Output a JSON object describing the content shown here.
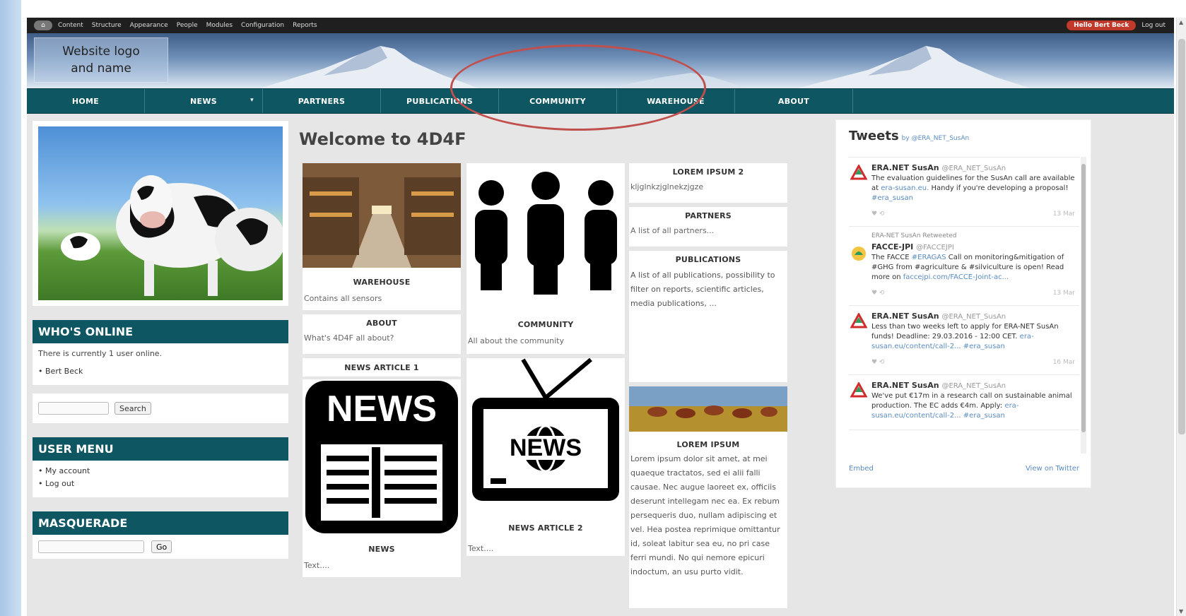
{
  "admin_toolbar": {
    "home_label": "⌂",
    "items": [
      "Content",
      "Structure",
      "Appearance",
      "People",
      "Modules",
      "Configuration",
      "Reports"
    ],
    "hello": "Hello Bert Beck",
    "logout": "Log out"
  },
  "header": {
    "logo_text_line1": "Website logo",
    "logo_text_line2": "and name"
  },
  "nav": {
    "items": [
      "HOME",
      "NEWS",
      "PARTNERS",
      "PUBLICATIONS",
      "COMMUNITY",
      "WAREHOUSE",
      "ABOUT"
    ],
    "news_caret": "▾"
  },
  "left": {
    "whos_online_title": "WHO'S ONLINE",
    "whos_online_text": "There is currently 1 user online.",
    "online_user": "Bert Beck",
    "search_button": "Search",
    "user_menu_title": "USER MENU",
    "user_menu_items": [
      "My account",
      "Log out"
    ],
    "masquerade_title": "MASQUERADE",
    "masquerade_button": "Go"
  },
  "main": {
    "welcome_title": "Welcome to 4D4F",
    "cards": {
      "warehouse_title": "WAREHOUSE",
      "warehouse_text": "Contains all sensors",
      "community_title": "COMMUNITY",
      "community_text": "All about the community",
      "about_title": "ABOUT",
      "about_text": "What's 4D4F all about?",
      "lorem2_title": "LOREM IPSUM 2",
      "lorem2_text": "kljglnkzjglnekzjgze",
      "partners_title": "PARTNERS",
      "partners_text": "A list of all partners...",
      "publications_title": "PUBLICATIONS",
      "publications_text": "A list of all publications, possibility to filter on reports, scientific articles, media publications, ...",
      "news_article1_title": "NEWS ARTICLE 1",
      "news_icon_text": "NEWS",
      "news_title": "NEWS",
      "news_text": "Text....",
      "news_article2_title": "NEWS ARTICLE 2",
      "tv_news_text": "NEWS",
      "news_article2_text": "Text....",
      "lorem_title": "LOREM IPSUM",
      "lorem_text": "Lorem ipsum dolor sit amet, at mei quaeque tractatos, sed ei alii falli causae. Nec augue laoreet ex, officiis deserunt intellegam nec ea. Ex rebum persequeris duo, nullam adipiscing et vel. Hea postea reprimique omittantur id, soleat labitur sea eu, no pri case ferri mundi. No qui nemore epicuri indoctum, an usu purto vidit."
    }
  },
  "tweets": {
    "title": "Tweets",
    "by": "by @ERA_NET_SusAn",
    "items": [
      {
        "author": "ERA.NET SusAn",
        "handle": "@ERA_NET_SusAn",
        "text": "The evaluation guidelines for the SusAn call are available at",
        "link": "era-susan.eu.",
        "text2": " Handy if you're developing a proposal!",
        "tag": "#era_susan",
        "time": "13 Mar"
      },
      {
        "retweet": "ERA-NET SusAn Retweeted",
        "author": "FACCE-JPI",
        "handle": "@FACCEJPI",
        "text": "The FACCE",
        "link": "#ERAGAS",
        "text2": " Call on monitoring&mitigation of #GHG from #agriculture & #silviculture is open! Read more on",
        "tag": "faccejpi.com/FACCE-Joint-ac...",
        "time": "13 Mar"
      },
      {
        "author": "ERA.NET SusAn",
        "handle": "@ERA_NET_SusAn",
        "text": "Less than two weeks left to apply for ERA-NET SusAn funds! Deadline: 29.03.2016 - 12:00 CET.",
        "link": "era-susan.eu/content/call-2...",
        "text2": " ",
        "tag": "#era_susan",
        "time": "16 Mar"
      },
      {
        "author": "ERA.NET SusAn",
        "handle": "@ERA_NET_SusAn",
        "text": "We've put €17m in a research call on sustainable animal production. The EC adds €4m. Apply:",
        "link": "era-susan.eu/content/call-2...",
        "text2": " ",
        "tag": "#era_susan",
        "time": ""
      }
    ],
    "embed": "Embed",
    "view_on_twitter": "View on Twitter"
  },
  "colors": {
    "nav_bg": "#0f5663",
    "highlight": "#c0504d",
    "admin_bg": "#1f1f1f",
    "hello_badge": "#c0392b"
  }
}
